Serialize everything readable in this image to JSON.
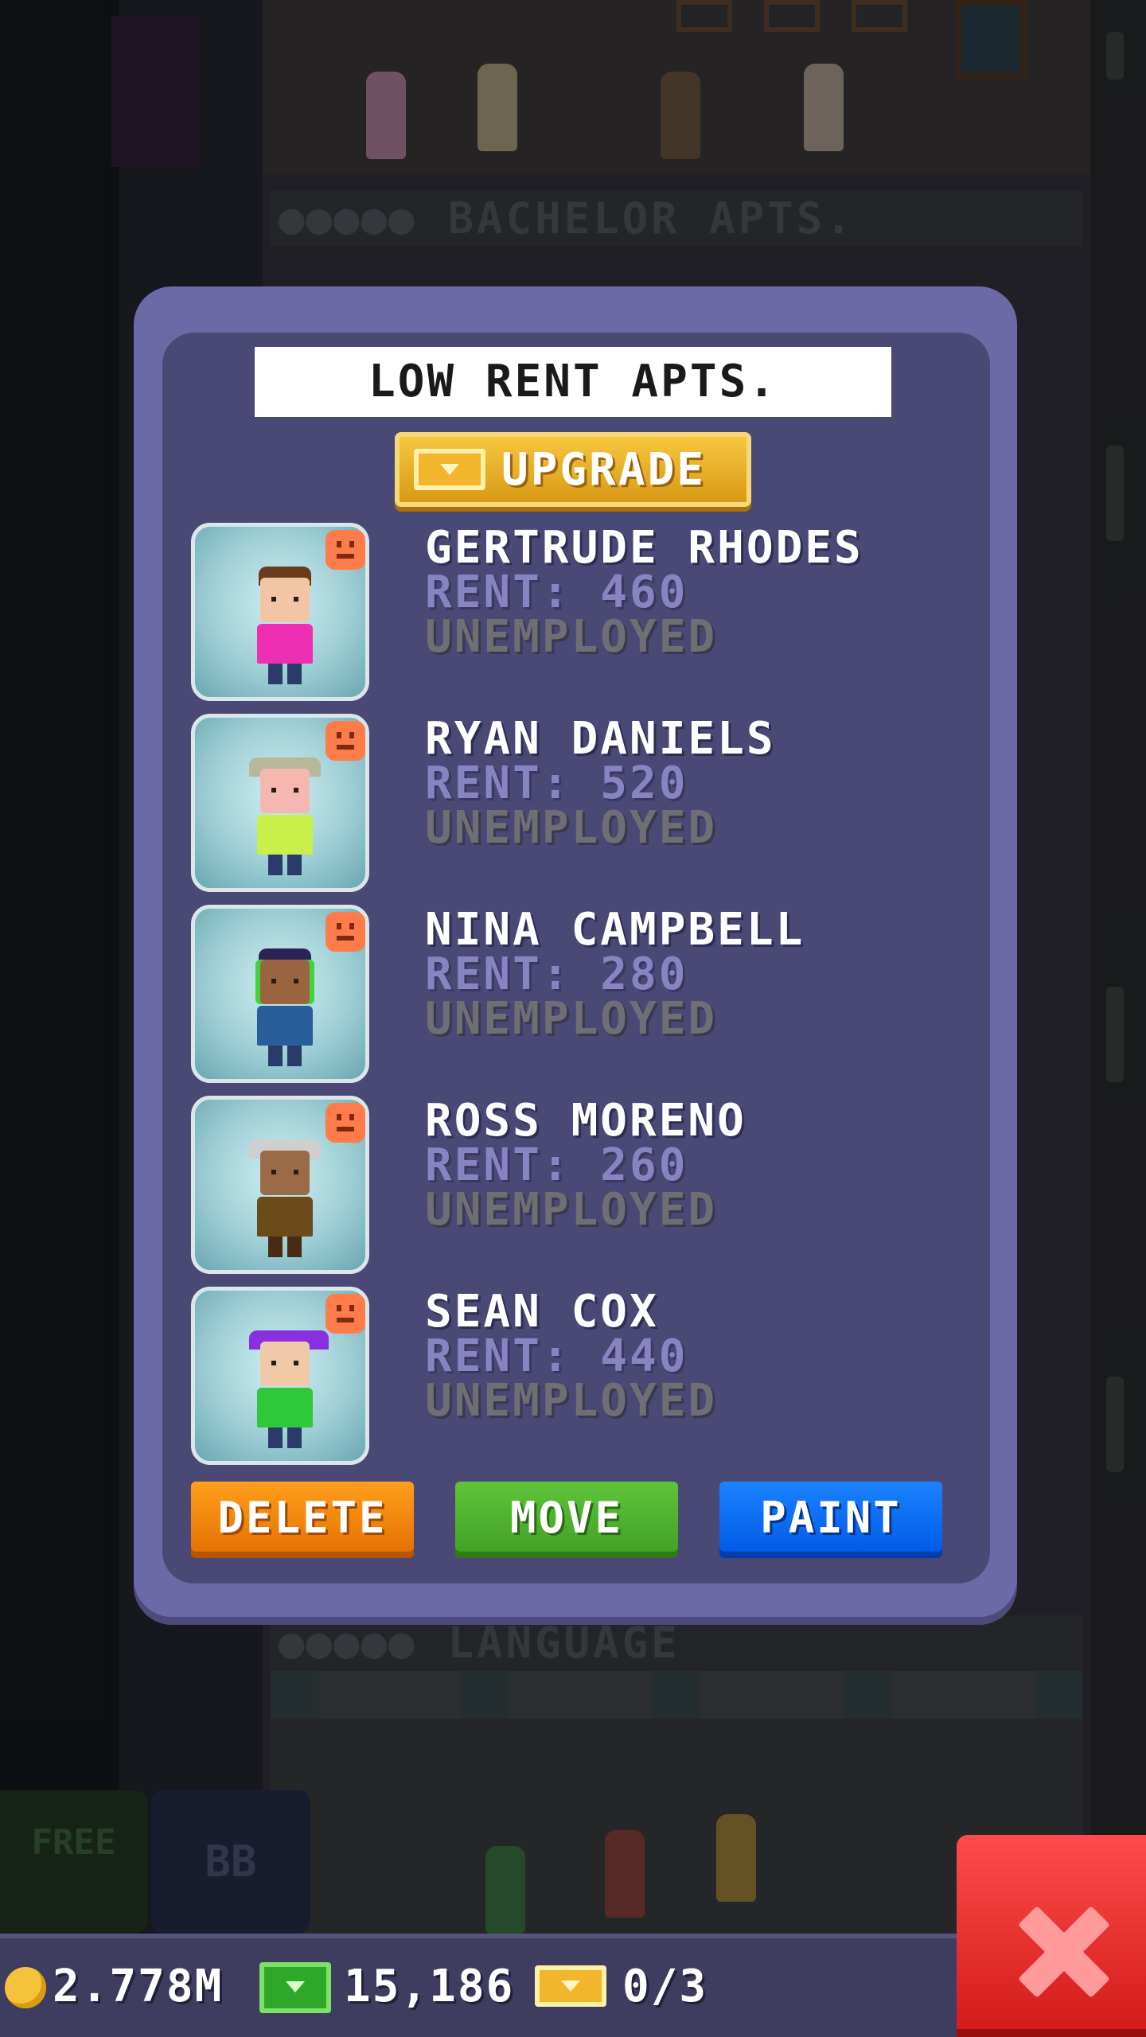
{
  "floor": {
    "above_label": "BACHELOR APTS.",
    "below_label": "LANGUAGE",
    "free_label": "FREE",
    "bb_label": "BB"
  },
  "dialog": {
    "title": "LOW RENT APTS.",
    "upgrade_label": "UPGRADE",
    "tenants": [
      {
        "name": "GERTRUDE RHODES",
        "rent": "RENT: 460",
        "job": "UNEMPLOYED",
        "mood": "unhappy",
        "colors": {
          "hair": "#6b3b1e",
          "skin": "#f2c6a4",
          "shirt": "#ee2fb2"
        }
      },
      {
        "name": "RYAN DANIELS",
        "rent": "RENT: 520",
        "job": "UNEMPLOYED",
        "mood": "unhappy",
        "colors": {
          "hair": "#b7b89a",
          "skin": "#f4b8b0",
          "shirt": "#c9f04a"
        }
      },
      {
        "name": "NINA CAMPBELL",
        "rent": "RENT: 280",
        "job": "UNEMPLOYED",
        "mood": "unhappy",
        "colors": {
          "hair": "#2a2454",
          "skin": "#9a6540",
          "shirt": "#2a5e9a"
        }
      },
      {
        "name": "ROSS MORENO",
        "rent": "RENT: 260",
        "job": "UNEMPLOYED",
        "mood": "unhappy",
        "colors": {
          "hair": "#cfcfcf",
          "skin": "#9b6b48",
          "shirt": "#6b4b1a"
        }
      },
      {
        "name": "SEAN COX",
        "rent": "RENT: 440",
        "job": "UNEMPLOYED",
        "mood": "unhappy",
        "colors": {
          "hair": "#8a2fe0",
          "skin": "#f0c9a8",
          "shirt": "#2ec83a"
        }
      }
    ],
    "actions": {
      "delete_label": "DELETE",
      "move_label": "MOVE",
      "paint_label": "PAINT"
    }
  },
  "status": {
    "coins": "2.778M",
    "bux": "15,186",
    "tickets": "0/3"
  },
  "colors": {
    "panel": "#6c6aa6",
    "panel_inner": "#4a4875",
    "upgrade": "#f2b62b",
    "delete": "#f08a0c",
    "move": "#4fb02e",
    "paint": "#0a6ef5",
    "close": "#e62a2a"
  }
}
